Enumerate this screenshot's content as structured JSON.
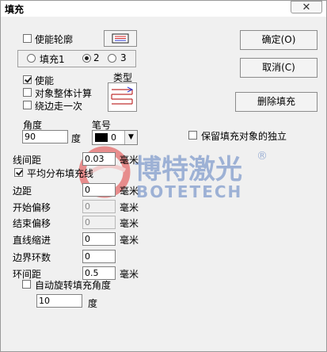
{
  "window": {
    "title": "填充"
  },
  "buttons": {
    "ok": "确定(O)",
    "cancel": "取消(C)",
    "delete_fill": "删除填充"
  },
  "outline": {
    "enable_label": "使能轮廓",
    "enabled": false
  },
  "fill_tabs": {
    "items": [
      "填充1",
      "2",
      "3"
    ],
    "selected": 1
  },
  "fill": {
    "enable_label": "使能",
    "enabled": true,
    "whole_calc_label": "对象整体计算",
    "whole_calc": false,
    "edge_once_label": "绕边走一次",
    "edge_once": false,
    "type_label": "类型",
    "angle_label": "角度",
    "angle_value": "90",
    "angle_unit": "度",
    "pen_label": "笔号",
    "pen_value": "0",
    "pen_color": "#000000",
    "keep_independent_label": "保留填充对象的独立",
    "keep_independent": false
  },
  "params": [
    {
      "label": "线间距",
      "value": "0.03",
      "unit": "毫米",
      "disabled": false
    },
    {
      "label": "边距",
      "value": "0",
      "unit": "毫米",
      "disabled": false
    },
    {
      "label": "开始偏移",
      "value": "0",
      "unit": "毫米",
      "disabled": true
    },
    {
      "label": "结束偏移",
      "value": "0",
      "unit": "毫米",
      "disabled": true
    },
    {
      "label": "直线缩进",
      "value": "0",
      "unit": "毫米",
      "disabled": false
    },
    {
      "label": "边界环数",
      "value": "0",
      "unit": "",
      "disabled": false
    },
    {
      "label": "环间距",
      "value": "0.5",
      "unit": "毫米",
      "disabled": false
    }
  ],
  "even_distribute": {
    "label": "平均分布填充线",
    "checked": true
  },
  "auto_rotate": {
    "label": "自动旋转填充角度",
    "checked": false,
    "value": "10",
    "unit": "度"
  },
  "watermark": {
    "text_cn": "博特激光",
    "text_en": "BOTETECH",
    "reg": "®",
    "color": "#e03c3c"
  }
}
